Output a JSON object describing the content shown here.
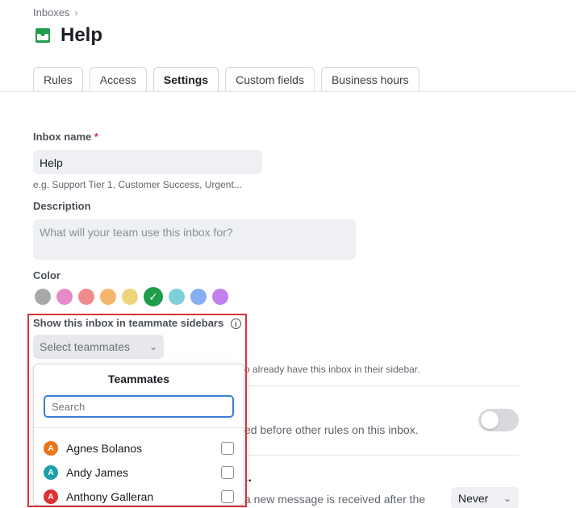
{
  "breadcrumb": {
    "parent": "Inboxes"
  },
  "page": {
    "title": "Help"
  },
  "tabs": [
    {
      "label": "Rules"
    },
    {
      "label": "Access"
    },
    {
      "label": "Settings"
    },
    {
      "label": "Custom fields"
    },
    {
      "label": "Business hours"
    }
  ],
  "form": {
    "inbox_name_label": "Inbox name",
    "required_mark": "*",
    "inbox_name_value": "Help",
    "inbox_name_hint": "e.g. Support Tier 1, Customer Success, Urgent...",
    "description_label": "Description",
    "description_placeholder": "What will your team use this inbox for?",
    "color_label": "Color",
    "colors": [
      "#a8a8a8",
      "#e48bc7",
      "#f08b8b",
      "#f5b56f",
      "#eed47b",
      "#1f9d4a",
      "#7fcfd6",
      "#86aef2",
      "#c27ff0"
    ],
    "selected_color_index": 5,
    "sidebar_label": "Show this inbox in teammate sidebars",
    "sidebar_select_placeholder": "Select teammates",
    "sidebar_hint_partial": "o already have this inbox in their sidebar.",
    "rules_hint_partial": "ed before other rules on this inbox.",
    "section_title_partial": "..",
    "new_message_hint_partial": "a new message is received after the",
    "never_select": "Never"
  },
  "popover": {
    "title": "Teammates",
    "search_placeholder": "Search",
    "teammates": [
      {
        "initial": "A",
        "name": "Agnes Bolanos",
        "color": "#ec7418"
      },
      {
        "initial": "A",
        "name": "Andy James",
        "color": "#1ea0aa"
      },
      {
        "initial": "A",
        "name": "Anthony Galleran",
        "color": "#df2f2f"
      }
    ]
  }
}
